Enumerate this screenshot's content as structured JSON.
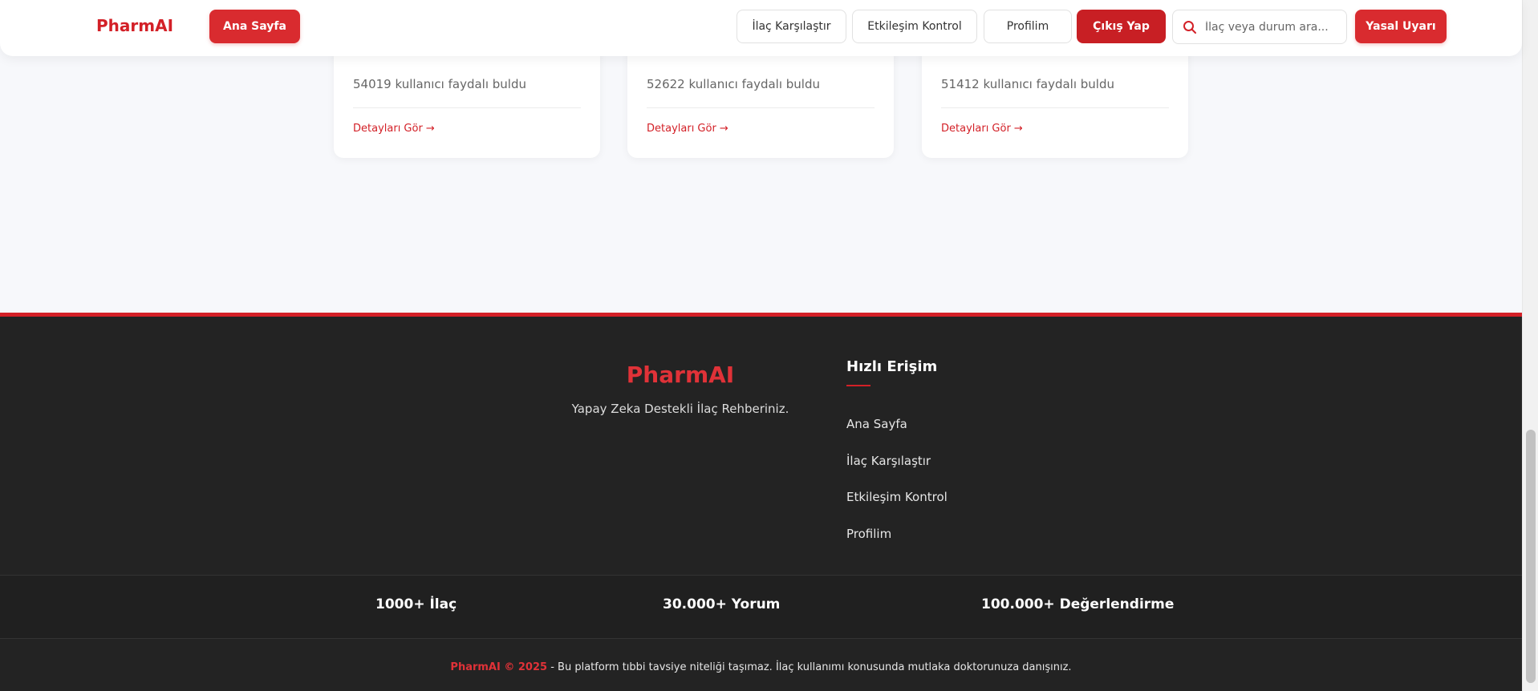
{
  "header": {
    "brand": "PharmAI",
    "home_button": "Ana Sayfa",
    "nav": {
      "compare": "İlaç Karşılaştır",
      "interaction": "Etkileşim Kontrol",
      "profile": "Profilim",
      "logout": "Çıkış Yap"
    },
    "search": {
      "placeholder": "İlaç veya durum ara...",
      "value": ""
    },
    "legal_button": "Yasal Uyarı"
  },
  "cards": [
    {
      "helpful": "54019 kullanıcı faydalı buldu",
      "details": "Detayları Gör →"
    },
    {
      "helpful": "52622 kullanıcı faydalı buldu",
      "details": "Detayları Gör →"
    },
    {
      "helpful": "51412 kullanıcı faydalı buldu",
      "details": "Detayları Gör →"
    }
  ],
  "footer": {
    "brand": "PharmAI",
    "tagline": "Yapay Zeka Destekli İlaç Rehberiniz.",
    "quick_access": {
      "title": "Hızlı Erişim",
      "links": [
        "Ana Sayfa",
        "İlaç Karşılaştır",
        "Etkileşim Kontrol",
        "Profilim"
      ]
    },
    "stats": [
      "1000+ İlaç",
      "30.000+ Yorum",
      "100.000+ Değerlendirme"
    ],
    "copyright": {
      "brand": "PharmAI © 2025",
      "text": " - Bu platform tıbbi tavsiye niteliği taşımaz. İlaç kullanımı konusunda mutlaka doktorunuza danışınız."
    }
  },
  "colors": {
    "accent": "#d32027",
    "footer_bg": "#232323",
    "page_bg": "#f7f8fb"
  }
}
